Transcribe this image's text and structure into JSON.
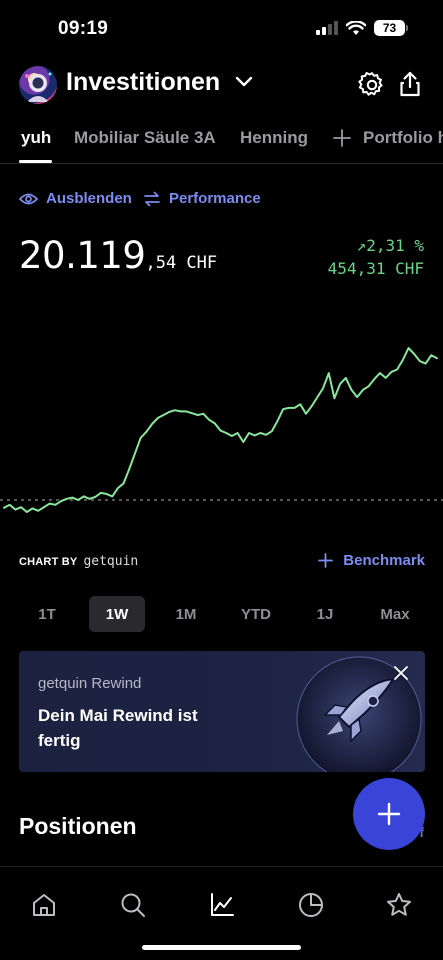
{
  "status_bar": {
    "time": "09:19",
    "battery": "73"
  },
  "header": {
    "title": "Investitionen"
  },
  "tabs": [
    {
      "label": "yuh",
      "active": true
    },
    {
      "label": "Mobiliar Säule 3A",
      "active": false
    },
    {
      "label": "Henning",
      "active": false
    },
    {
      "label": "Portfolio h",
      "active": false
    }
  ],
  "actions": {
    "hide_label": "Ausblenden",
    "performance_label": "Performance"
  },
  "portfolio": {
    "value_main": "20.119",
    "value_decimals": ",54",
    "currency": " CHF",
    "change_percent": "↗2,31 %",
    "change_abs": "454,31 CHF"
  },
  "chart_data": {
    "type": "line",
    "y": [
      0.95,
      1.0,
      0.92,
      0.96,
      0.88,
      0.94,
      0.9,
      0.96,
      1.02,
      1.0,
      1.06,
      1.1,
      1.12,
      1.08,
      1.14,
      1.1,
      1.13,
      1.2,
      1.18,
      1.14,
      1.28,
      1.36,
      1.6,
      1.86,
      2.12,
      2.22,
      2.35,
      2.45,
      2.5,
      2.55,
      2.58,
      2.56,
      2.56,
      2.53,
      2.5,
      2.52,
      2.42,
      2.36,
      2.24,
      2.2,
      2.15,
      2.2,
      2.05,
      2.2,
      2.16,
      2.2,
      2.17,
      2.23,
      2.4,
      2.6,
      2.62,
      2.62,
      2.68,
      2.52,
      2.65,
      2.8,
      2.95,
      3.2,
      2.78,
      3.02,
      3.12,
      2.92,
      2.8,
      2.92,
      2.98,
      3.1,
      3.2,
      3.12,
      3.22,
      3.26,
      3.42,
      3.62,
      3.52,
      3.4,
      3.36,
      3.5,
      3.45
    ],
    "baseline": 1.08,
    "series_color": "#8ae69d"
  },
  "chart_footer": {
    "label": "CHART BY",
    "brand": "getquin",
    "benchmark_label": "Benchmark"
  },
  "ranges": [
    {
      "label": "1T",
      "active": false
    },
    {
      "label": "1W",
      "active": true
    },
    {
      "label": "1M",
      "active": false
    },
    {
      "label": "YTD",
      "active": false
    },
    {
      "label": "1J",
      "active": false
    },
    {
      "label": "Max",
      "active": false
    }
  ],
  "card": {
    "kicker": "getquin Rewind",
    "text": "Dein Mai Rewind ist fertig"
  },
  "positions": {
    "title": "Positionen",
    "peek_text": "f"
  },
  "nav": [
    "home-icon",
    "search-icon",
    "chart-icon",
    "pie-icon",
    "star-icon"
  ]
}
